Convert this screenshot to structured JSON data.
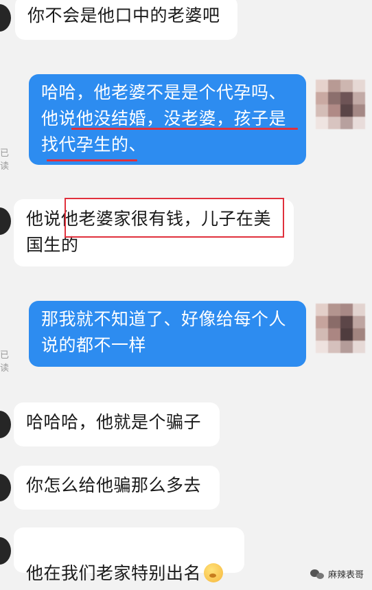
{
  "messages": [
    {
      "side": "in",
      "text": "你不会是他口中的老婆吧"
    },
    {
      "side": "out",
      "text": "哈哈，他老婆不是是个代孕吗、\n他说他没结婚，没老婆，孩子是\n找代孕生的、",
      "read_label": "已读"
    },
    {
      "side": "in",
      "text": "他说他老婆家很有钱，儿子在美\n国生的"
    },
    {
      "side": "out",
      "text": "那我就不知道了、好像给每个人\n说的都不一样",
      "read_label": "已读"
    },
    {
      "side": "in",
      "text": "哈哈哈，他就是个骗子"
    },
    {
      "side": "in",
      "text": "你怎么给他骗那么多去"
    },
    {
      "side": "in",
      "text": "他在我们老家特别出名"
    }
  ],
  "watermark": {
    "text": "麻辣表哥"
  },
  "colors": {
    "outgoing_bubble": "#2d8cf0",
    "incoming_bubble": "#ffffff",
    "annotation": "#e0303c"
  }
}
